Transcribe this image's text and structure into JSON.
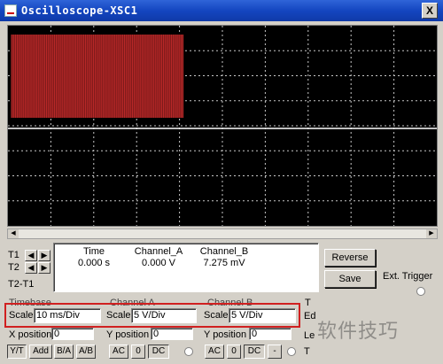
{
  "window": {
    "title": "Oscilloscope-XSC1",
    "close_label": "X"
  },
  "colors": {
    "trace_red": "#c02a2a",
    "grid": "#c8c8c8",
    "trace_white": "#ffffff",
    "highlight": "#d02020"
  },
  "readout": {
    "headers": [
      "Time",
      "Channel_A",
      "Channel_B"
    ],
    "cursors": [
      "T1",
      "T2",
      "T2-T1"
    ],
    "t1": {
      "time": "0.000 s",
      "channel_a": "0.000 V",
      "channel_b": "7.275 mV"
    }
  },
  "buttons": {
    "reverse": "Reverse",
    "save": "Save",
    "ext_trigger": "Ext. Trigger"
  },
  "timebase": {
    "title": "Timebase",
    "scale_label": "Scale",
    "scale_value": "10 ms/Div",
    "xpos_label": "X position",
    "xpos_value": "0",
    "modes": [
      "Y/T",
      "Add",
      "B/A",
      "A/B"
    ]
  },
  "channel_a": {
    "title": "Channel A",
    "scale_label": "Scale",
    "scale_value": "5 V/Div",
    "ypos_label": "Y position",
    "ypos_value": "0",
    "coupling": [
      "AC",
      "0",
      "DC"
    ]
  },
  "channel_b": {
    "title": "Channel B",
    "scale_label": "Scale",
    "scale_value": "5 V/Div",
    "ypos_label": "Y position",
    "ypos_value": "0",
    "coupling": [
      "AC",
      "0",
      "DC",
      "-"
    ]
  },
  "cut_text": {
    "t1": "T",
    "ed": "Ed",
    "le": "Le",
    "t2": "T"
  },
  "watermark": "软件技巧"
}
